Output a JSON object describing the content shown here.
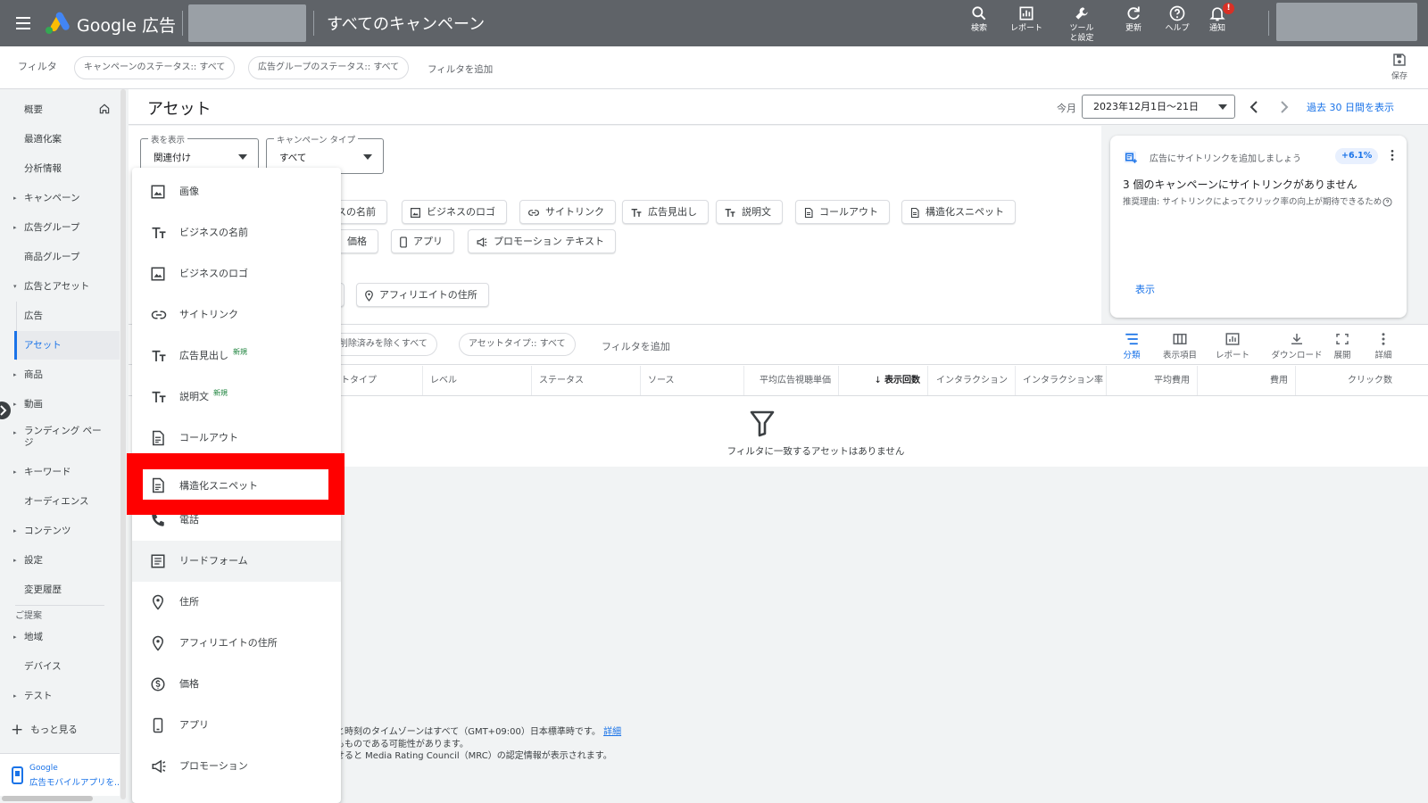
{
  "topbar": {
    "brand": "Google 広告",
    "page_title": "すべてのキャンペーン",
    "tools": [
      {
        "label": "検索",
        "icon": "search-icon"
      },
      {
        "label": "レポート",
        "icon": "report-icon"
      },
      {
        "label": "ツールと設定",
        "icon": "wrench-icon"
      },
      {
        "label": "更新",
        "icon": "refresh-icon"
      },
      {
        "label": "ヘルプ",
        "icon": "help-icon"
      },
      {
        "label": "通知",
        "icon": "bell-icon"
      }
    ],
    "notification_badge": "!"
  },
  "filterbar": {
    "label": "フィルタ",
    "chips": [
      "キャンペーンのステータス:: すべて",
      "広告グループのステータス:: すべて"
    ],
    "add_filter": "フィルタを追加",
    "save_label": "保存"
  },
  "sidebar": {
    "items": [
      {
        "label": "概要"
      },
      {
        "label": "最適化案"
      },
      {
        "label": "分析情報"
      },
      {
        "label": "キャンペーン"
      },
      {
        "label": "広告グループ"
      },
      {
        "label": "商品グループ"
      },
      {
        "label": "広告とアセット"
      },
      {
        "label": "広告"
      },
      {
        "label": "アセット"
      },
      {
        "label": "商品"
      },
      {
        "label": "動画"
      },
      {
        "label": "ランディング ページ"
      },
      {
        "label": "キーワード"
      },
      {
        "label": "オーディエンス"
      },
      {
        "label": "コンテンツ"
      },
      {
        "label": "設定"
      },
      {
        "label": "変更履歴"
      }
    ],
    "suggest_heading": "ご提案",
    "suggest_items": [
      {
        "label": "地域"
      },
      {
        "label": "デバイス"
      },
      {
        "label": "テスト"
      }
    ],
    "more": "もっと見る",
    "mobile_app_line1": "Google",
    "mobile_app_line2": "広告モバイルアプリを..."
  },
  "header": {
    "title": "アセット",
    "period_label": "今月",
    "date_range": "2023年12月1日〜21日",
    "last30": "過去 30 日間を表示"
  },
  "selectors": {
    "view": {
      "label": "表を表示",
      "value": "関連付け"
    },
    "campaign_type": {
      "label": "キャンペーン タイプ",
      "value": "すべて"
    }
  },
  "asset_chips_row1": [
    "スの名前",
    "ビジネスのロゴ",
    "サイトリンク",
    "広告見出し",
    "説明文",
    "コールアウト",
    "構造化スニペット"
  ],
  "asset_chips_row2": [
    "価格",
    "アプリ",
    "プロモーション テキスト"
  ],
  "asset_chip_affiliate": "アフィリエイトの住所",
  "recommendation": {
    "title": "広告にサイトリンクを追加しましょう",
    "badge": "+6.1%",
    "headline": "3 個のキャンペーンにサイトリンクがありません",
    "body": "推奨理由: サイトリンクによってクリック率の向上が期待できるため",
    "link": "表示"
  },
  "table": {
    "filter_chips": [
      ":: 削除済みを除くすべて",
      "アセットタイプ:: すべて"
    ],
    "add_filter": "フィルタを追加",
    "toolbar": [
      "分類",
      "表示項目",
      "レポート",
      "ダウンロード",
      "展開",
      "詳細"
    ],
    "columns": [
      "ットタイプ",
      "レベル",
      "ステータス",
      "ソース",
      "平均広告視聴単価",
      "表示回数",
      "インタラクション",
      "インタラクション率",
      "平均費用",
      "費用",
      "クリック数"
    ],
    "empty_message": "フィルタに一致するアセットはありません"
  },
  "footer": {
    "line1": "付と時刻のタイムゾーンはすべて（GMT+09:00）日本標準時です。",
    "line1_link": "詳細",
    "line2": "ともものである可能性があります。",
    "line3": "わせると Media Rating Council（MRC）の認定情報が表示されます。"
  },
  "dropdown": {
    "new_tag": "新規",
    "items": [
      {
        "label": "画像",
        "icon": "image-icon"
      },
      {
        "label": "ビジネスの名前",
        "icon": "text-icon"
      },
      {
        "label": "ビジネスのロゴ",
        "icon": "image-icon"
      },
      {
        "label": "サイトリンク",
        "icon": "link-icon"
      },
      {
        "label": "広告見出し",
        "icon": "text-icon",
        "new": true
      },
      {
        "label": "説明文",
        "icon": "text-icon",
        "new": true
      },
      {
        "label": "コールアウト",
        "icon": "document-icon"
      },
      {
        "label": "構造化スニペット",
        "icon": "document-icon"
      },
      {
        "label": "電話",
        "icon": "phone-icon"
      },
      {
        "label": "リードフォーム",
        "icon": "form-icon"
      },
      {
        "label": "住所",
        "icon": "location-icon"
      },
      {
        "label": "アフィリエイトの住所",
        "icon": "location-icon"
      },
      {
        "label": "価格",
        "icon": "price-icon"
      },
      {
        "label": "アプリ",
        "icon": "app-icon"
      },
      {
        "label": "プロモーション",
        "icon": "megaphone-icon"
      }
    ]
  },
  "colors": {
    "topbar": "#5f6368",
    "accent": "#1a73e8",
    "highlight": "#ff0000"
  }
}
